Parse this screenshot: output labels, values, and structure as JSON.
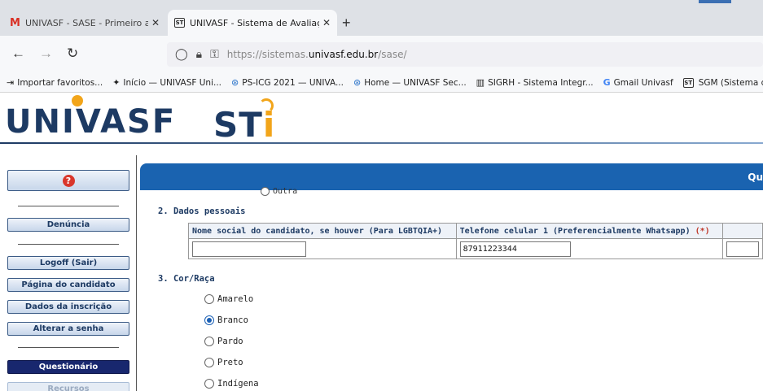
{
  "browser": {
    "tabs": [
      {
        "title": "UNIVASF - SASE - Primeiro aces",
        "icon": "gmail-icon"
      },
      {
        "title": "UNIVASF - Sistema de Avaliação",
        "icon": "sti-icon"
      }
    ],
    "favicon_text": "ST",
    "new_tab": "+",
    "close": "✕",
    "url_prefix": "https://sistemas.",
    "url_domain": "univasf.edu.br",
    "url_path": "/sase/",
    "bookmarks": [
      {
        "label": "Importar favoritos...",
        "icon": "import-icon"
      },
      {
        "label": "Início — UNIVASF Uni...",
        "icon": "univasf-icon"
      },
      {
        "label": "PS-ICG 2021 — UNIVA...",
        "icon": "globe-icon"
      },
      {
        "label": "Home — UNIVASF Sec...",
        "icon": "globe-icon"
      },
      {
        "label": "SIGRH - Sistema Integr...",
        "icon": "sig-icon"
      },
      {
        "label": "Gmail Univasf",
        "icon": "google-icon"
      },
      {
        "label": "SGM (Sistema de Gest",
        "icon": "st-icon"
      }
    ]
  },
  "logos": {
    "univasf": "UNIVASF",
    "sti_prefix": "ST",
    "sti_suffix": "i"
  },
  "sidebar": {
    "help": "?",
    "denuncia": "Denúncia",
    "logoff": "Logoff (Sair)",
    "pagina": "Página do candidato",
    "dados": "Dados da inscrição",
    "senha": "Alterar a senha",
    "questionario": "Questionário",
    "recursos": "Recursos"
  },
  "header": {
    "text": "Qu"
  },
  "form": {
    "outra_label": "Outra",
    "section2_title": "2. Dados pessoais",
    "col_nome_social": "Nome social do candidato, se houver (Para LGBTQIA+)",
    "col_telefone": "Telefone celular 1 (Preferencialmente Whatsapp)",
    "required_mark": "(*)",
    "nome_social_value": "",
    "telefone_value": "87911223344",
    "section3_title": "3. Cor/Raça",
    "options": [
      {
        "label": "Amarelo",
        "selected": false
      },
      {
        "label": "Branco",
        "selected": true
      },
      {
        "label": "Pardo",
        "selected": false
      },
      {
        "label": "Preto",
        "selected": false
      },
      {
        "label": "Indígena",
        "selected": false
      }
    ]
  },
  "colors": {
    "accent": "#1a63b0",
    "current_item": "#18276e",
    "brand_navy": "#1d3a63",
    "brand_orange": "#f2a51a"
  }
}
